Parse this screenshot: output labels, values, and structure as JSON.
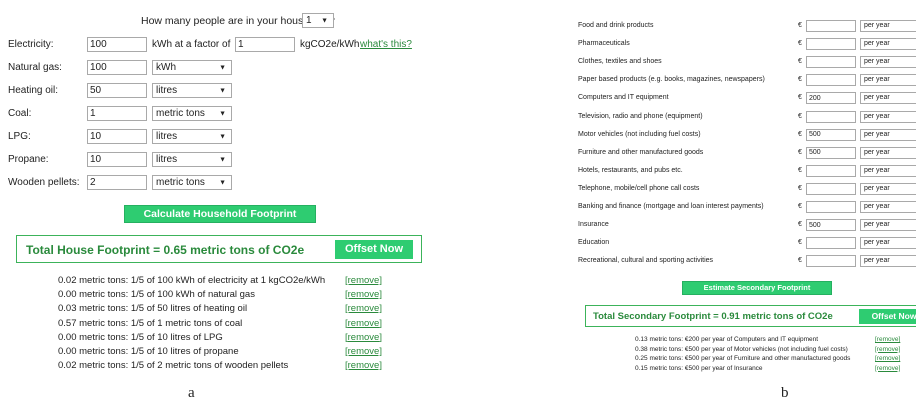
{
  "panel_a": {
    "people_question": "How many people are in your household?",
    "people_value": "1",
    "electricity": {
      "label": "Electricity:",
      "value": "100",
      "factor_text": "kWh at a factor of",
      "factor_value": "1",
      "unit_text": "kgCO2e/kWh",
      "help_link": "what's this?"
    },
    "rows": [
      {
        "label": "Natural gas:",
        "value": "100",
        "unit": "kWh"
      },
      {
        "label": "Heating oil:",
        "value": "50",
        "unit": "litres"
      },
      {
        "label": "Coal:",
        "value": "1",
        "unit": "metric tons"
      },
      {
        "label": "LPG:",
        "value": "10",
        "unit": "litres"
      },
      {
        "label": "Propane:",
        "value": "10",
        "unit": "litres"
      },
      {
        "label": "Wooden pellets:",
        "value": "2",
        "unit": "metric tons"
      }
    ],
    "calculate_button": "Calculate Household Footprint",
    "total_text": "Total House Footprint = 0.65 metric tons of CO2e",
    "offset_button": "Offset Now",
    "remove_label": "[remove]",
    "results": [
      "0.02 metric tons: 1/5 of 100 kWh of electricity at 1 kgCO2e/kWh",
      "0.00 metric tons: 1/5 of 100 kWh of natural gas",
      "0.03 metric tons: 1/5 of 50 litres of heating oil",
      "0.57 metric tons: 1/5 of 1 metric tons of coal",
      "0.00 metric tons: 1/5 of 10 litres of LPG",
      "0.00 metric tons: 1/5 of 10 litres of propane",
      "0.02 metric tons: 1/5 of 2 metric tons of wooden pellets"
    ],
    "caption": "a"
  },
  "panel_b": {
    "currency": "€",
    "period": "per year",
    "rows": [
      {
        "label": "Food and drink products",
        "value": ""
      },
      {
        "label": "Pharmaceuticals",
        "value": ""
      },
      {
        "label": "Clothes, textiles and shoes",
        "value": ""
      },
      {
        "label": "Paper based products (e.g. books, magazines, newspapers)",
        "value": ""
      },
      {
        "label": "Computers and IT equipment",
        "value": "200"
      },
      {
        "label": "Television, radio and phone (equipment)",
        "value": ""
      },
      {
        "label": "Motor vehicles (not including fuel costs)",
        "value": "500"
      },
      {
        "label": "Furniture and other manufactured goods",
        "value": "500"
      },
      {
        "label": "Hotels, restaurants, and pubs etc.",
        "value": ""
      },
      {
        "label": "Telephone, mobile/cell phone call costs",
        "value": ""
      },
      {
        "label": "Banking and finance (mortgage and loan interest payments)",
        "value": ""
      },
      {
        "label": "Insurance",
        "value": "500"
      },
      {
        "label": "Education",
        "value": ""
      },
      {
        "label": "Recreational, cultural and sporting activities",
        "value": ""
      }
    ],
    "estimate_button": "Estimate Secondary Footprint",
    "total_text": "Total Secondary Footprint = 0.91 metric tons of CO2e",
    "offset_button": "Offset Now",
    "remove_label": "[remove]",
    "results": [
      "0.13 metric tons: €200 per year of Computers and IT equipment",
      "0.38 metric tons: €500 per year of Motor vehicles (not including fuel costs)",
      "0.25 metric tons: €500 per year of Furniture and other manufactured goods",
      "0.15 metric tons: €500 per year of Insurance"
    ],
    "caption": "b"
  }
}
